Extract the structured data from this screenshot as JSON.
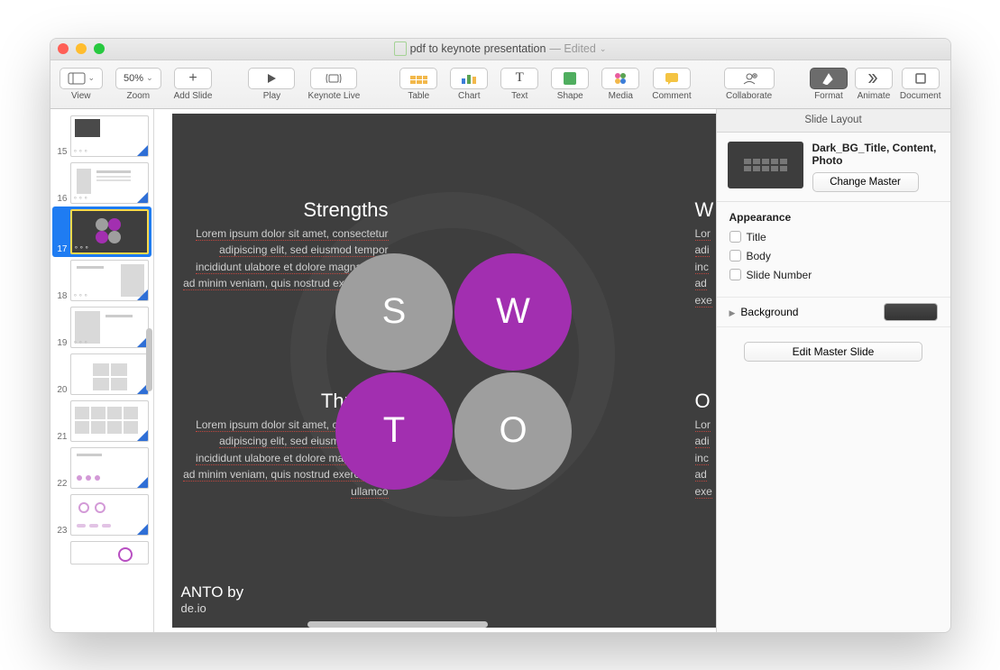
{
  "window": {
    "title": "pdf to keynote presentation",
    "status": "— Edited",
    "chevron": "⌄"
  },
  "toolbar": {
    "view": "View",
    "zoom": "Zoom",
    "zoom_value": "50%",
    "chev": "⌄",
    "addslide": "Add Slide",
    "play": "Play",
    "live": "Keynote Live",
    "table": "Table",
    "chart": "Chart",
    "text": "Text",
    "shape": "Shape",
    "media": "Media",
    "comment": "Comment",
    "collab": "Collaborate",
    "format": "Format",
    "animate": "Animate",
    "document": "Document"
  },
  "thumbs": {
    "nums": [
      "15",
      "16",
      "17",
      "18",
      "19",
      "20",
      "21",
      "22",
      "23",
      ""
    ]
  },
  "slide": {
    "strengths": {
      "title": "Strengths",
      "body": "Lorem ipsum dolor sit amet, consectetur adipiscing elit, sed eiusmod tempor incididunt ulabore et dolore magna enim ad minim veniam, quis nostrud exercitation ullamco"
    },
    "threats": {
      "title": "Threats",
      "body": "Lorem ipsum dolor sit amet, consectetur adipiscing elit, sed eiusmod tempor incididunt ulabore et dolore magna enim ad minim veniam, quis nostrud exercitation ullamco"
    },
    "weak": {
      "title_initial": "W"
    },
    "opp": {
      "title_initial": "O"
    },
    "right_body_frag": "Lor\nadi\ninc\nad\nexe",
    "letters": {
      "s": "S",
      "w": "W",
      "t": "T",
      "o": "O"
    },
    "footer1": "ANTO by",
    "footer2": "de.io"
  },
  "inspector": {
    "header": "Slide Layout",
    "master_name": "Dark_BG_Title, Content, Photo",
    "change_master": "Change Master",
    "appearance": "Appearance",
    "title_chk": "Title",
    "body_chk": "Body",
    "slidenum_chk": "Slide Number",
    "background": "Background",
    "edit_master": "Edit Master Slide"
  }
}
